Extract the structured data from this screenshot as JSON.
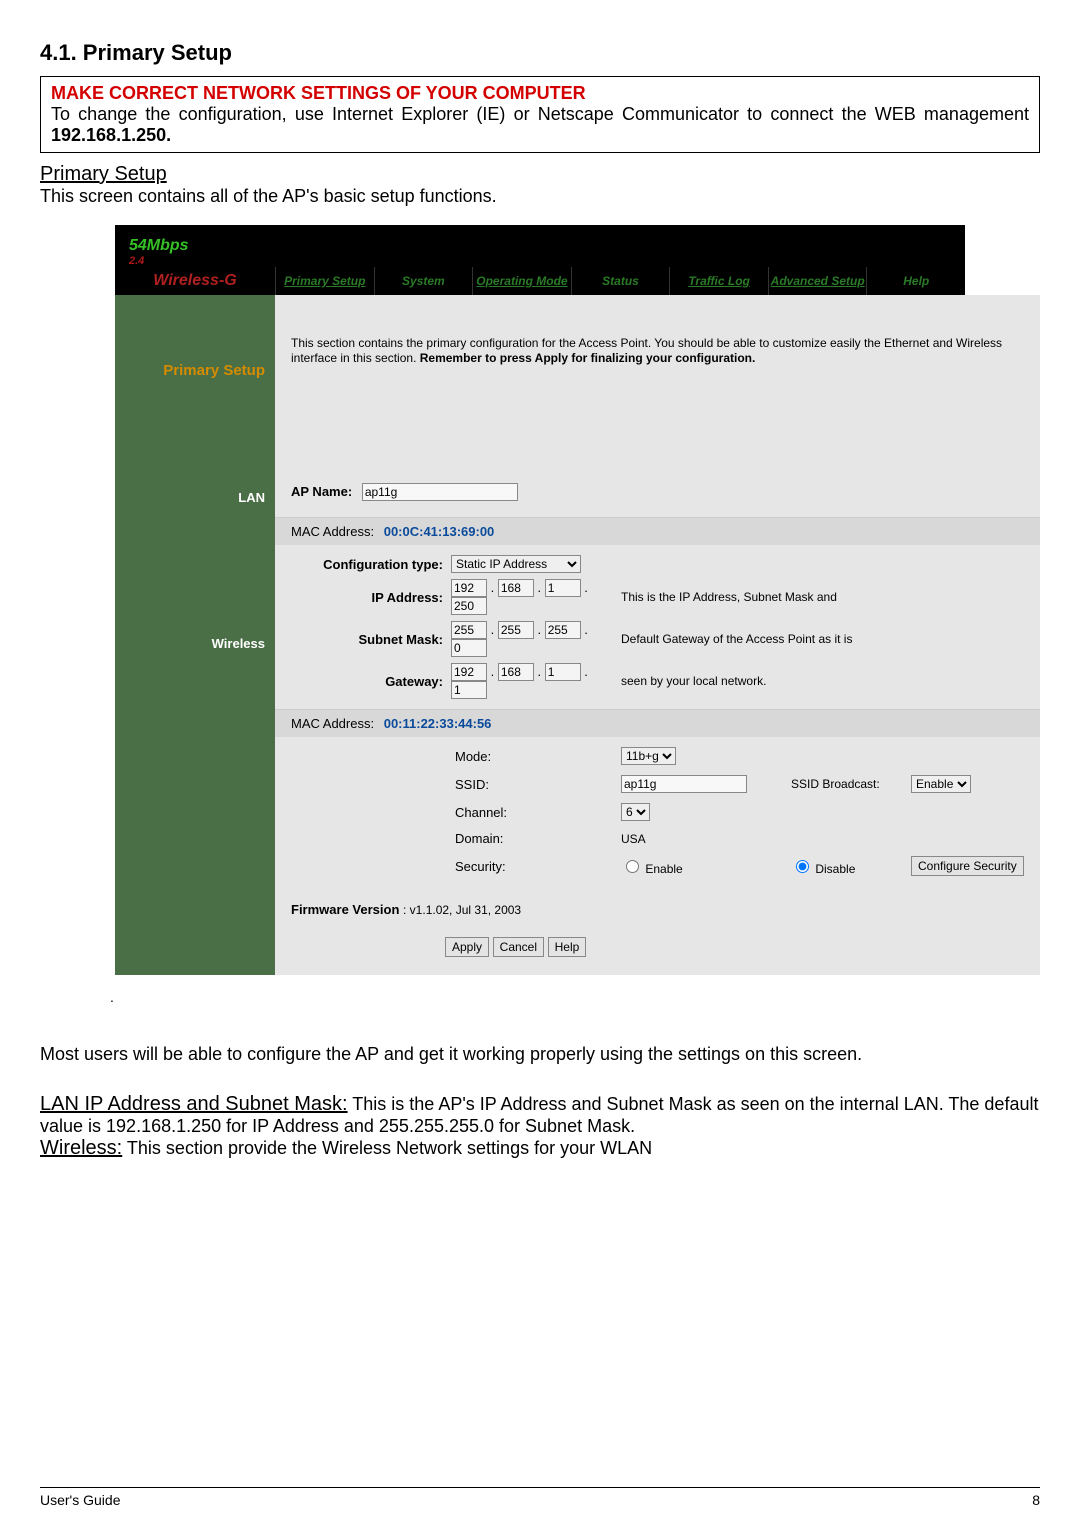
{
  "section_number": "4.1. Primary Setup",
  "callout": {
    "heading": "MAKE CORRECT NETWORK SETTINGS OF YOUR COMPUTER",
    "line1": "To change the configuration, use Internet Explorer (IE) or Netscape Communicator to connect the WEB management ",
    "addr": "192.168.1.250."
  },
  "primary_setup_heading": "Primary Setup",
  "primary_setup_desc": "This screen contains all of the AP's basic setup functions.",
  "shot": {
    "logo_line1": "54Mbps",
    "logo_line2": "2.4",
    "brand": "Wireless-G",
    "nav": [
      "Primary Setup",
      "System",
      "Operating Mode",
      "Status",
      "Traffic Log",
      "Advanced Setup",
      "Help"
    ],
    "side": {
      "primary_setup": "Primary Setup",
      "lan": "LAN",
      "wireless": "Wireless"
    },
    "intro1": "This section contains the primary configuration for the Access Point. You should be able to customize easily the Ethernet and Wireless interface in this section. ",
    "intro_bold": "Remember to press Apply for finalizing your configuration.",
    "ap_name_label": "AP Name:",
    "ap_name_value": "ap11g",
    "lan_mac_prefix": "MAC Address: ",
    "lan_mac": "00:0C:41:13:69:00",
    "conf_type_label": "Configuration type:",
    "conf_type_value": "Static IP Address",
    "ip_label": "IP Address:",
    "ip": [
      "192",
      "168",
      "1",
      "250"
    ],
    "sm_label": "Subnet Mask:",
    "sm": [
      "255",
      "255",
      "255",
      "0"
    ],
    "gw_label": "Gateway:",
    "gw": [
      "192",
      "168",
      "1",
      "1"
    ],
    "lan_note1": "This is the IP Address, Subnet Mask and",
    "lan_note2": "Default Gateway of the Access Point as it is",
    "lan_note3": "seen by your local network.",
    "wl_mac_prefix": "MAC Address: ",
    "wl_mac": "00:11:22:33:44:56",
    "mode_label": "Mode:",
    "mode_value": "11b+g",
    "ssid_label": "SSID:",
    "ssid_value": "ap11g",
    "ssid_bcast_label": "SSID Broadcast:",
    "ssid_bcast_value": "Enable",
    "channel_label": "Channel:",
    "channel_value": "6",
    "domain_label": "Domain:",
    "domain_value": "USA",
    "security_label": "Security:",
    "security_enable": "Enable",
    "security_disable": "Disable",
    "config_security_btn": "Configure Security",
    "fw_label": "Firmware Version",
    "fw_value": ": v1.1.02, Jul 31, 2003",
    "apply_btn": "Apply",
    "cancel_btn": "Cancel",
    "help_btn": "Help"
  },
  "body2": "Most users will be able to configure the AP and get it working properly using the settings on this screen.",
  "lan_head": "LAN IP Address and Subnet Mask:",
  "lan_body": " This is the AP's IP Address and Subnet Mask as seen on the internal LAN. The default value is 192.168.1.250 for IP Address and 255.255.255.0 for Subnet Mask.",
  "wl_head": "Wireless:",
  "wl_body": "  This section provide the Wireless Network settings for your WLAN",
  "footer_left": "User's Guide",
  "footer_right": "8"
}
